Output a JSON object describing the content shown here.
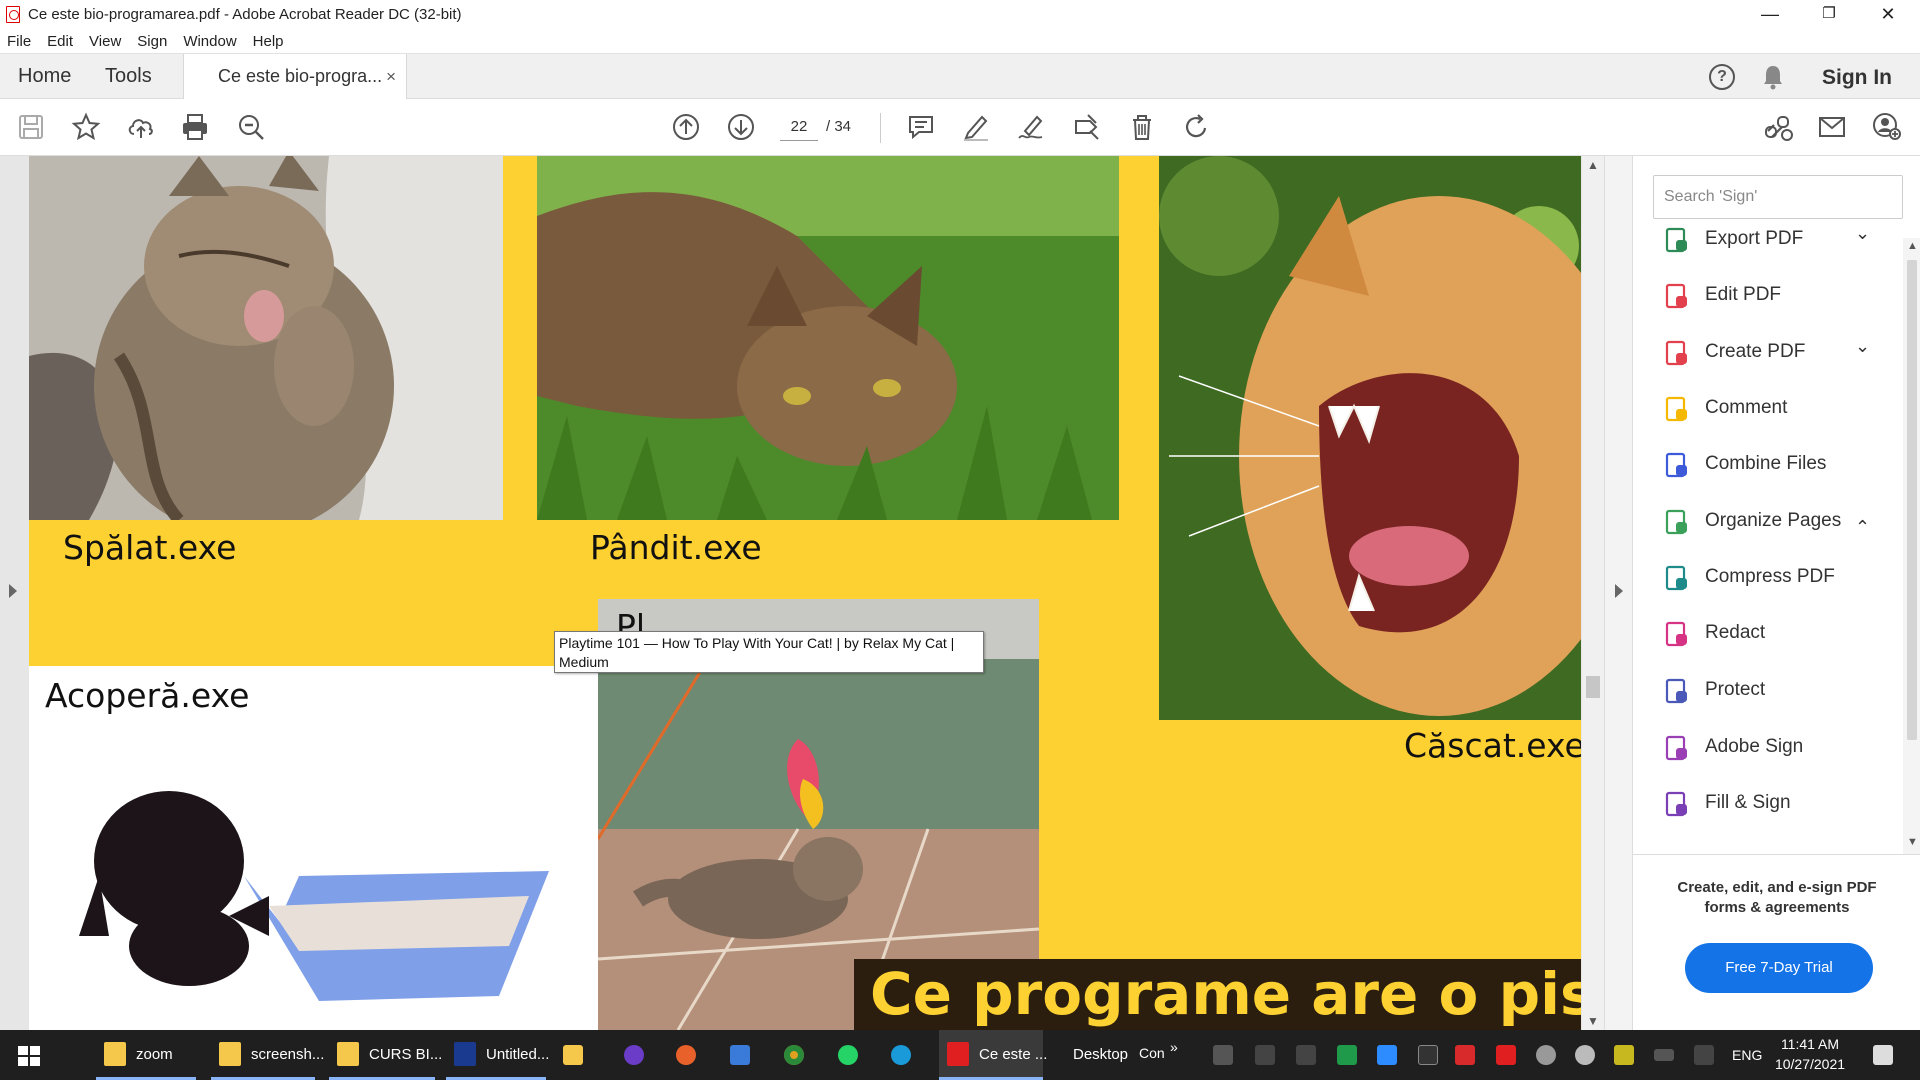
{
  "window": {
    "title": "Ce este bio-programarea.pdf - Adobe Acrobat Reader DC (32-bit)",
    "minimize": "—",
    "restore": "❐",
    "close": "✕"
  },
  "menu": [
    "File",
    "Edit",
    "View",
    "Sign",
    "Window",
    "Help"
  ],
  "tabs": {
    "home": "Home",
    "tools": "Tools",
    "document": "Ce este bio-progra...",
    "close": "×",
    "help": "?",
    "sign_in": "Sign In"
  },
  "toolbar": {
    "current_page": "22",
    "total_pages": "/  34"
  },
  "document": {
    "captions": {
      "spalat": "Spălat.exe",
      "pandit": "Pândit.exe",
      "cascat": "Căscat.exe",
      "acopera": "Acoperă.exe",
      "partial": "Pl"
    },
    "banner": "Ce programe are o pisică",
    "tooltip": "Playtime 101 — How To Play With Your Cat! | by Relax My Cat | Medium",
    "page_bg": "#fdd131"
  },
  "tools_pane": {
    "search_placeholder": "Search 'Sign'",
    "items": [
      {
        "label": "Export PDF",
        "icon": "export-pdf-icon",
        "chevron": "⌄",
        "color": "#2e8b57"
      },
      {
        "label": "Edit PDF",
        "icon": "edit-pdf-icon",
        "chevron": "",
        "color": "#e2404d"
      },
      {
        "label": "Create PDF",
        "icon": "create-pdf-icon",
        "chevron": "⌄",
        "color": "#e2404d"
      },
      {
        "label": "Comment",
        "icon": "comment-icon",
        "chevron": "",
        "color": "#f5b800"
      },
      {
        "label": "Combine Files",
        "icon": "combine-files-icon",
        "chevron": "",
        "color": "#3d5ad8"
      },
      {
        "label": "Organize Pages",
        "icon": "organize-pages-icon",
        "chevron": "⌃",
        "color": "#3aa05a"
      },
      {
        "label": "Compress PDF",
        "icon": "compress-pdf-icon",
        "chevron": "",
        "color": "#1f8a8a"
      },
      {
        "label": "Redact",
        "icon": "redact-icon",
        "chevron": "",
        "color": "#d63384"
      },
      {
        "label": "Protect",
        "icon": "protect-icon",
        "chevron": "",
        "color": "#4a58b8"
      },
      {
        "label": "Adobe Sign",
        "icon": "adobe-sign-icon",
        "chevron": "",
        "color": "#9b3fb5"
      },
      {
        "label": "Fill & Sign",
        "icon": "fill-sign-icon",
        "chevron": "",
        "color": "#7b3fb5"
      }
    ],
    "promo": "Create, edit, and e-sign PDF forms & agreements",
    "trial_button": "Free 7-Day Trial"
  },
  "taskbar": {
    "apps": [
      {
        "label": "zoom",
        "icon": "folder-icon",
        "color": "#f5c84c"
      },
      {
        "label": "screensh...",
        "icon": "folder-icon",
        "color": "#f5c84c"
      },
      {
        "label": "CURS BI...",
        "icon": "folder-icon",
        "color": "#f5c84c"
      },
      {
        "label": "Untitled...",
        "icon": "photoshop-icon",
        "color": "#1a3a8f"
      },
      {
        "label": "Ce este ...",
        "icon": "acrobat-icon",
        "color": "#e02020"
      }
    ],
    "desktop": "Desktop",
    "con": "Con",
    "more": "»",
    "lang": "ENG",
    "time": "11:41 AM",
    "date": "10/27/2021"
  }
}
